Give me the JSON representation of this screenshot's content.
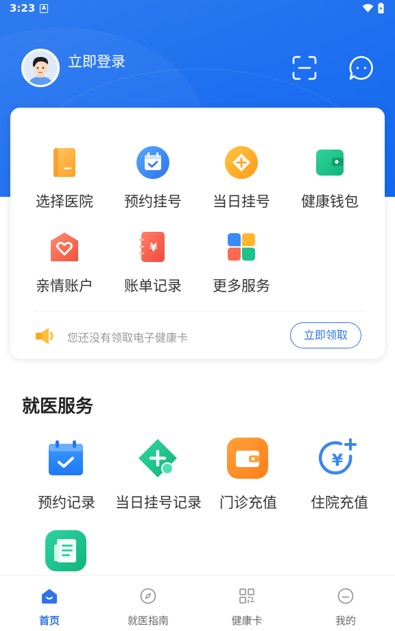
{
  "status_bar": {
    "time": "3:23",
    "notification_glyph": "A"
  },
  "header": {
    "login_label": "立即登录",
    "icons": [
      "scan-icon",
      "message-icon"
    ]
  },
  "quick_actions": [
    {
      "label": "选择医院",
      "icon": "hospital-book-icon"
    },
    {
      "label": "预约挂号",
      "icon": "calendar-check-icon"
    },
    {
      "label": "当日挂号",
      "icon": "diamond-plus-icon"
    },
    {
      "label": "健康钱包",
      "icon": "wallet-icon"
    },
    {
      "label": "亲情账户",
      "icon": "family-heart-icon"
    },
    {
      "label": "账单记录",
      "icon": "bill-icon"
    },
    {
      "label": "更多服务",
      "icon": "more-services-icon"
    }
  ],
  "notice": {
    "text": "您还没有领取电子健康卡",
    "button_label": "立即领取"
  },
  "medical_services": {
    "title": "就医服务",
    "items": [
      {
        "label": "预约记录",
        "icon": "appointment-record-icon"
      },
      {
        "label": "当日挂号记录",
        "icon": "same-day-record-icon"
      },
      {
        "label": "门诊充值",
        "icon": "outpatient-recharge-icon"
      },
      {
        "label": "住院充值",
        "icon": "inpatient-recharge-icon"
      },
      {
        "label": "",
        "icon": "document-list-icon"
      }
    ]
  },
  "bottom_nav": {
    "active_index": 0,
    "items": [
      {
        "label": "首页",
        "icon": "home-icon"
      },
      {
        "label": "就医指南",
        "icon": "compass-icon"
      },
      {
        "label": "健康卡",
        "icon": "qr-card-icon"
      },
      {
        "label": "我的",
        "icon": "profile-icon"
      }
    ]
  },
  "colors": {
    "header_blue": "#1d6ff0",
    "accent_blue": "#2e74e6",
    "orange": "#ff9a2f",
    "green": "#1fc08a"
  }
}
